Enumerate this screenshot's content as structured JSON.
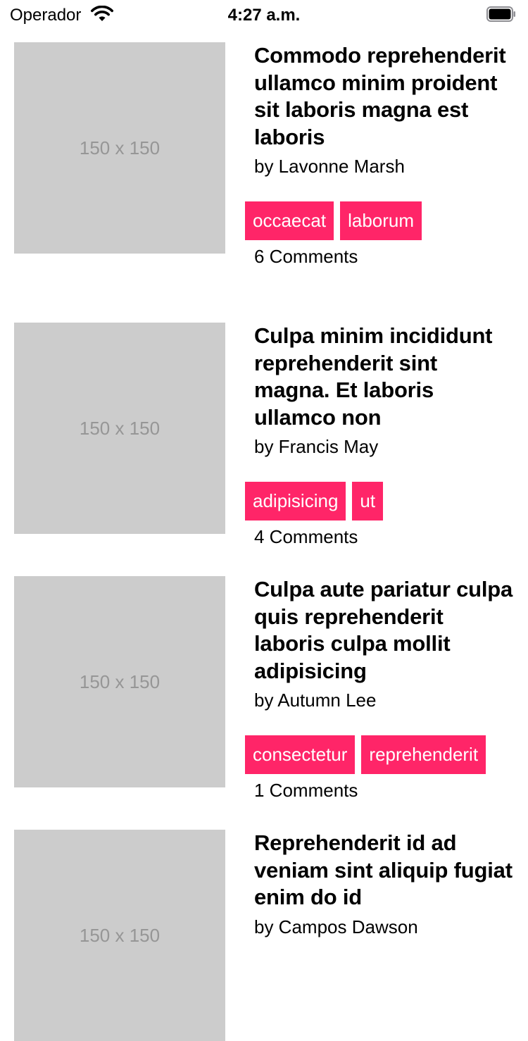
{
  "status_bar": {
    "carrier": "Operador",
    "time": "4:27 a.m.",
    "wifi_icon": "wifi-icon",
    "battery_icon": "battery-icon",
    "battery_level": 1.0
  },
  "colors": {
    "tag_background": "#ff2568",
    "thumbnail_placeholder": "#cccccc"
  },
  "posts": [
    {
      "image_text": "150 x 150",
      "title": "Commodo reprehenderit ullamco minim proident sit laboris magna est laboris",
      "author": "by Lavonne Marsh",
      "tags": [
        "occaecat",
        "laborum"
      ],
      "comments": "6 Comments"
    },
    {
      "image_text": "150 x 150",
      "title": "Culpa minim incididunt reprehenderit sint magna. Et laboris ullamco non",
      "author": "by Francis May",
      "tags": [
        "adipisicing",
        "ut"
      ],
      "comments": "4 Comments"
    },
    {
      "image_text": "150 x 150",
      "title": "Culpa aute pariatur culpa quis reprehenderit laboris culpa mollit adipisicing",
      "author": "by Autumn Lee",
      "tags": [
        "consectetur",
        "reprehenderit"
      ],
      "comments": "1 Comments"
    },
    {
      "image_text": "150 x 150",
      "title": "Reprehenderit id ad veniam sint aliquip fugiat enim do id",
      "author": "by Campos Dawson",
      "tags": [],
      "comments": ""
    }
  ]
}
